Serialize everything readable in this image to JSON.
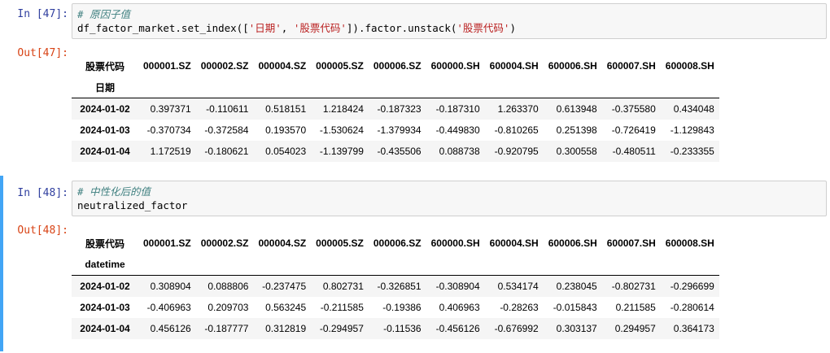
{
  "cells": [
    {
      "in_prompt": "In  [47]:",
      "code_comment": "# 原因子值",
      "code_prefix": "df_factor_market.set_index([",
      "code_str1": "'日期'",
      "code_mid": ", ",
      "code_str2": "'股票代码'",
      "code_mid2": "]).factor.unstack(",
      "code_str3": "'股票代码'",
      "code_suffix": ")",
      "out_prompt": "Out[47]:",
      "table": {
        "columns_label": "股票代码",
        "index_label": "日期",
        "columns": [
          "000001.SZ",
          "000002.SZ",
          "000004.SZ",
          "000005.SZ",
          "000006.SZ",
          "600000.SH",
          "600004.SH",
          "600006.SH",
          "600007.SH",
          "600008.SH"
        ],
        "rows": [
          {
            "index": "2024-01-02",
            "values": [
              "0.397371",
              "-0.110611",
              "0.518151",
              "1.218424",
              "-0.187323",
              "-0.187310",
              "1.263370",
              "0.613948",
              "-0.375580",
              "0.434048"
            ]
          },
          {
            "index": "2024-01-03",
            "values": [
              "-0.370734",
              "-0.372584",
              "0.193570",
              "-1.530624",
              "-1.379934",
              "-0.449830",
              "-0.810265",
              "0.251398",
              "-0.726419",
              "-1.129843"
            ]
          },
          {
            "index": "2024-01-04",
            "values": [
              "1.172519",
              "-0.180621",
              "0.054023",
              "-1.139799",
              "-0.435506",
              "0.088738",
              "-0.920795",
              "0.300558",
              "-0.480511",
              "-0.233355"
            ]
          }
        ]
      }
    },
    {
      "in_prompt": "In  [48]:",
      "code_comment": "# 中性化后的值",
      "code_line": "neutralized_factor",
      "out_prompt": "Out[48]:",
      "table": {
        "columns_label": "股票代码",
        "index_label": "datetime",
        "columns": [
          "000001.SZ",
          "000002.SZ",
          "000004.SZ",
          "000005.SZ",
          "000006.SZ",
          "600000.SH",
          "600004.SH",
          "600006.SH",
          "600007.SH",
          "600008.SH"
        ],
        "rows": [
          {
            "index": "2024-01-02",
            "values": [
              "0.308904",
              "0.088806",
              "-0.237475",
              "0.802731",
              "-0.326851",
              "-0.308904",
              "0.534174",
              "0.238045",
              "-0.802731",
              "-0.296699"
            ]
          },
          {
            "index": "2024-01-03",
            "values": [
              "-0.406963",
              "0.209703",
              "0.563245",
              "-0.211585",
              "-0.19386",
              "0.406963",
              "-0.28263",
              "-0.015843",
              "0.211585",
              "-0.280614"
            ]
          },
          {
            "index": "2024-01-04",
            "values": [
              "0.456126",
              "-0.187777",
              "0.312819",
              "-0.294957",
              "-0.11536",
              "-0.456126",
              "-0.676992",
              "0.303137",
              "0.294957",
              "0.364173"
            ]
          }
        ]
      }
    }
  ]
}
